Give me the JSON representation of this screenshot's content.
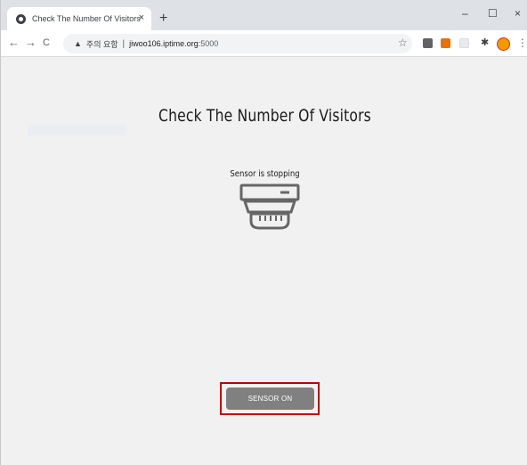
{
  "browser": {
    "tab_title": "Check The Number Of Visitors",
    "tab_close": "×",
    "new_tab": "+",
    "window_controls": {
      "minimize": "–",
      "maximize": "☐",
      "close": "×"
    },
    "nav": {
      "back": "←",
      "forward": "→",
      "reload": "C"
    },
    "address": {
      "security_icon": "▲",
      "security_label": "주의 요함",
      "separator": "|",
      "url_host": "jiwoo106.iptime.org",
      "url_port": ":5000"
    },
    "toolbar_icons": [
      "star-icon",
      "extension-icons",
      "puzzle-icon",
      "profile-avatar",
      "menu-icon"
    ],
    "star": "☆",
    "puzzle": "✱",
    "kebab": "⋮"
  },
  "page": {
    "title": "Check The Number Of Visitors",
    "status": "Sensor is stopping",
    "sensor_button_label": "SENSOR ON"
  },
  "colors": {
    "highlight_border": "#c00000",
    "button_bg": "#808080",
    "page_bg": "#f1f1f1"
  }
}
